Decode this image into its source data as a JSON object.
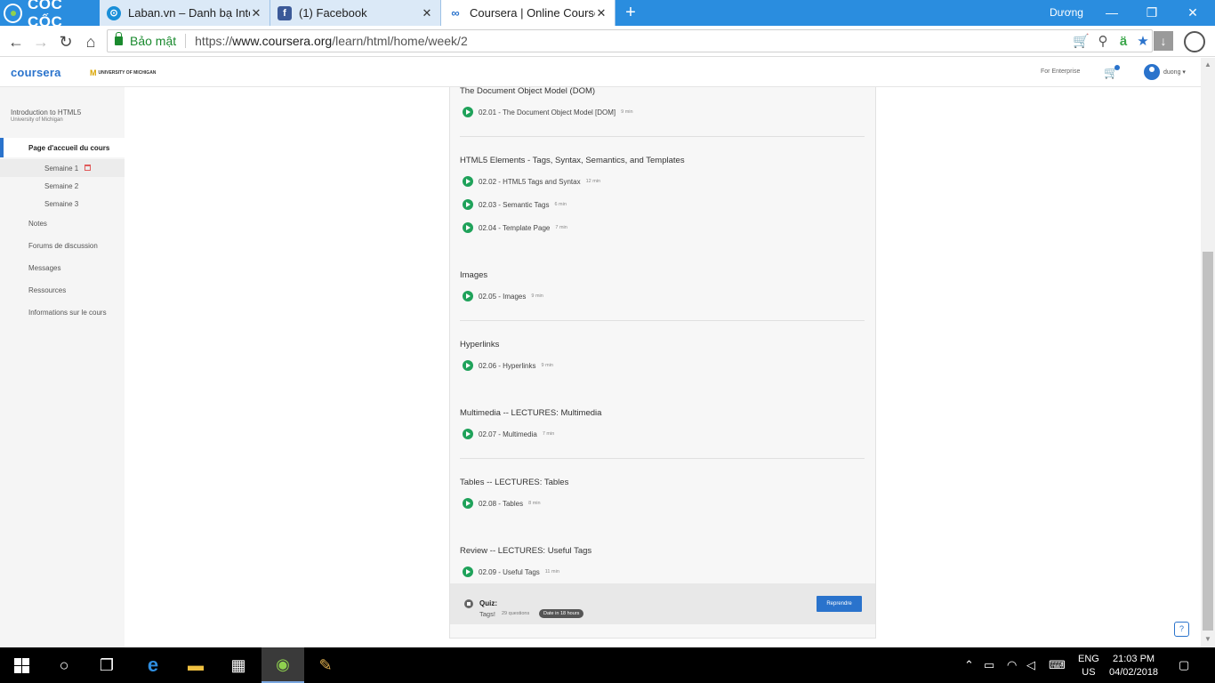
{
  "browser": {
    "brand": "CỐC CỐC",
    "tabs": [
      {
        "title": "Laban.vn – Danh bạ Internet",
        "icon": "compass-icon",
        "color": "#1a8fd8"
      },
      {
        "title": "(1) Facebook",
        "icon": "facebook-icon",
        "color": "#3b5998"
      },
      {
        "title": "Coursera | Online Courses",
        "icon": "coursera-icon",
        "color": "#2a73cc"
      }
    ],
    "user": "Dương",
    "security_label": "Bảo mật",
    "url_scheme": "https://",
    "url_host": "www.coursera.org",
    "url_path": "/learn/html/home/week/2"
  },
  "header": {
    "logo": "coursera",
    "university": "UNIVERSITY OF MICHIGAN",
    "for_enterprise": "For Enterprise",
    "username": "duong"
  },
  "sidebar": {
    "course_title": "Introduction to HTML5",
    "course_sub": "University of Michigan",
    "home": "Page d'accueil du cours",
    "weeks": [
      "Semaine 1",
      "Semaine 2",
      "Semaine 3"
    ],
    "links": [
      "Notes",
      "Forums de discussion",
      "Messages",
      "Ressources",
      "Informations sur le cours"
    ]
  },
  "sections": [
    {
      "title": "The Document Object Model (DOM)",
      "lessons": [
        {
          "title": "02.01 - The Document Object Model [DOM]",
          "duration": "9 min"
        }
      ]
    },
    {
      "title": "HTML5 Elements - Tags, Syntax, Semantics, and Templates",
      "lessons": [
        {
          "title": "02.02 - HTML5 Tags and Syntax",
          "duration": "12 min"
        },
        {
          "title": "02.03 - Semantic Tags",
          "duration": "6 min"
        },
        {
          "title": "02.04 - Template Page",
          "duration": "7 min"
        }
      ]
    },
    {
      "title": "Images",
      "lessons": [
        {
          "title": "02.05 - Images",
          "duration": "9 min"
        }
      ]
    },
    {
      "title": "Hyperlinks",
      "lessons": [
        {
          "title": "02.06 - Hyperlinks",
          "duration": "9 min"
        }
      ]
    },
    {
      "title": "Multimedia -- LECTURES: Multimedia",
      "lessons": [
        {
          "title": "02.07 - Multimedia",
          "duration": "7 min"
        }
      ]
    },
    {
      "title": "Tables -- LECTURES: Tables",
      "lessons": [
        {
          "title": "02.08 - Tables",
          "duration": "8 min"
        }
      ]
    },
    {
      "title": "Review -- LECTURES: Useful Tags",
      "lessons": [
        {
          "title": "02.09 - Useful Tags",
          "duration": "11 min"
        }
      ]
    }
  ],
  "quiz": {
    "label": "Quiz:",
    "name": "Tags!",
    "questions": "29 questions",
    "badge": "Date in 18 hours",
    "button": "Reprendre"
  },
  "taskbar": {
    "lang_top": "ENG",
    "lang_bottom": "US",
    "time": "21:03 PM",
    "date": "04/02/2018"
  }
}
